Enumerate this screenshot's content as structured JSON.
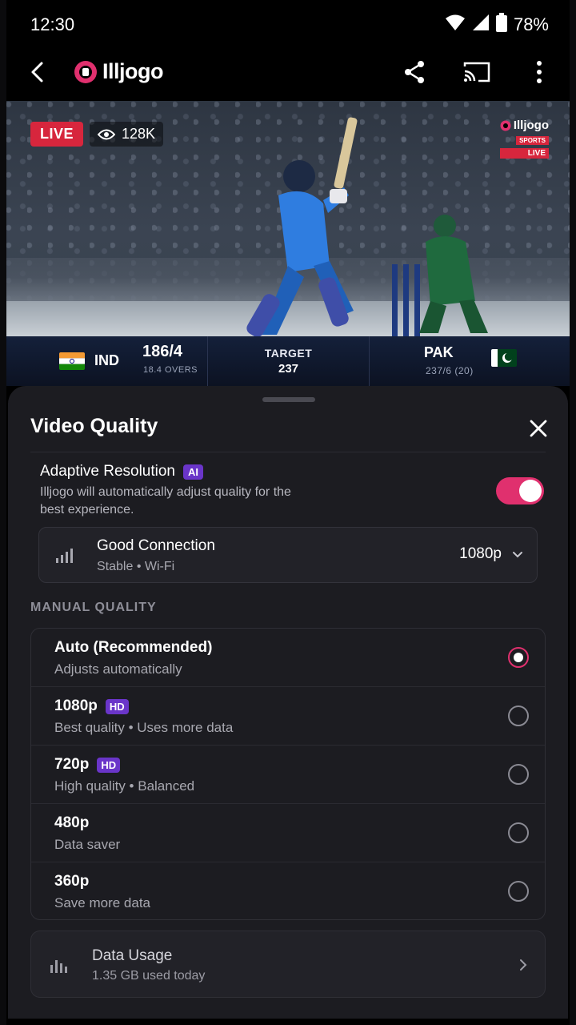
{
  "status_bar": {
    "time": "12:30",
    "battery": "78%"
  },
  "app": {
    "name": "Illjogo"
  },
  "video": {
    "live_label": "LIVE",
    "viewers": "128K",
    "watermark": {
      "brand": "Illjogo",
      "sub": "SPORTS",
      "live": "LIVE"
    }
  },
  "scoreboard": {
    "team_left": {
      "name": "IND",
      "score": "186/4",
      "overs": "18.4 OVERS"
    },
    "target_label": "TARGET",
    "target_value": "237",
    "team_right": {
      "name": "PAK",
      "score": "237/6 (20)"
    }
  },
  "sheet": {
    "title": "Video Quality",
    "adaptive": {
      "title": "Adaptive Resolution",
      "badge": "AI",
      "description": "Illjogo will automatically adjust quality for the best experience.",
      "enabled": true
    },
    "connection": {
      "title": "Good Connection",
      "subtitle": "Stable • Wi-Fi",
      "resolution": "1080p"
    },
    "manual_label": "MANUAL QUALITY",
    "options": [
      {
        "title": "Auto (Recommended)",
        "badge": "",
        "subtitle": "Adjusts automatically",
        "selected": true
      },
      {
        "title": "1080p",
        "badge": "HD",
        "subtitle": "Best quality • Uses more data",
        "selected": false
      },
      {
        "title": "720p",
        "badge": "HD",
        "subtitle": "High quality • Balanced",
        "selected": false
      },
      {
        "title": "480p",
        "badge": "",
        "subtitle": "Data saver",
        "selected": false
      },
      {
        "title": "360p",
        "badge": "",
        "subtitle": "Save more data",
        "selected": false
      }
    ],
    "data_usage": {
      "title": "Data Usage",
      "subtitle": "1.35 GB used today"
    }
  },
  "colors": {
    "accent": "#e0306e",
    "live_red": "#d7263d",
    "badge_purple": "#6a35c9",
    "sheet_bg": "#1c1c21"
  }
}
